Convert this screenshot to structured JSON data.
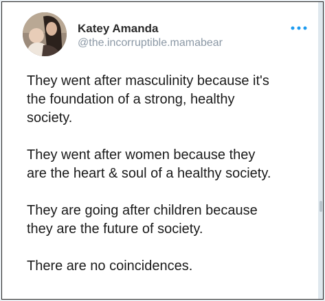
{
  "tweet": {
    "author": {
      "name": "Katey Amanda",
      "handle": "@the.incorruptible.mamabear",
      "avatar_icon": "profile-photo"
    },
    "more_icon": "more-options-icon",
    "paragraphs": [
      "They went after masculinity because it's\nthe foundation of a strong, healthy\nsociety.",
      "They went after women because they\nare the heart & soul of a healthy society.",
      "They are going after children because\nthey are the future of society.",
      "There are no coincidences."
    ]
  },
  "colors": {
    "text": "#1a1a1a",
    "handle": "#8b98a5",
    "more_dots": "#1d9bf0",
    "border": "#222222"
  }
}
